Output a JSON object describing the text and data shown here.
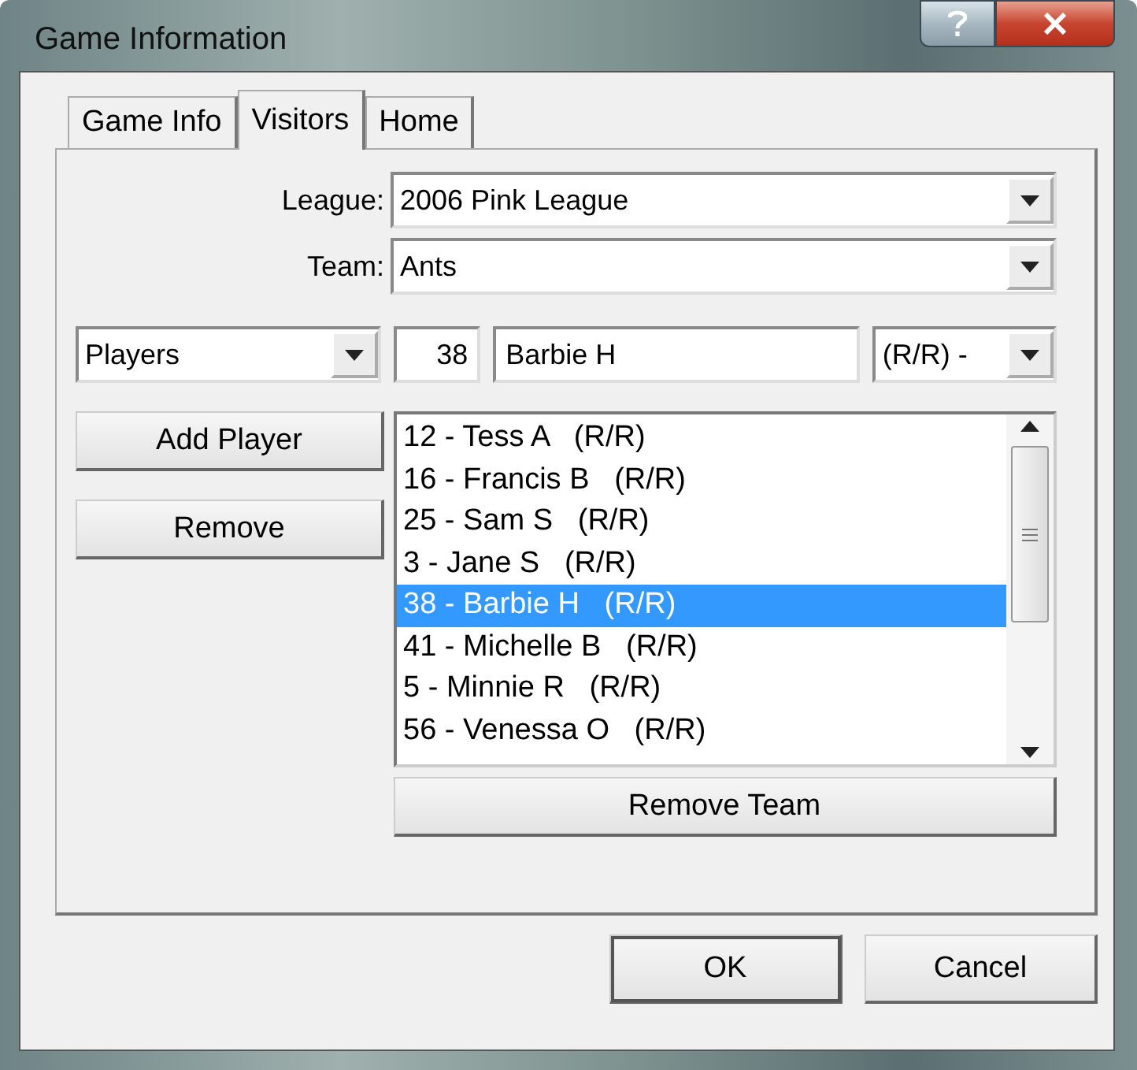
{
  "window": {
    "title": "Game Information"
  },
  "tabs": [
    {
      "label": "Game Info",
      "selected": false
    },
    {
      "label": "Visitors",
      "selected": true
    },
    {
      "label": "Home",
      "selected": false
    }
  ],
  "league": {
    "label": "League:",
    "value": "2006 Pink League"
  },
  "team": {
    "label": "Team:",
    "value": "Ants"
  },
  "player_entry": {
    "filter": "Players",
    "number": "38",
    "name": "Barbie H",
    "hand": "(R/R) -"
  },
  "side_buttons": [
    "Add Player",
    "Remove"
  ],
  "players": [
    {
      "text": "12 - Tess A   (R/R)",
      "selected": false
    },
    {
      "text": "16 - Francis B   (R/R)",
      "selected": false
    },
    {
      "text": "25 - Sam S   (R/R)",
      "selected": false
    },
    {
      "text": "3 - Jane S   (R/R)",
      "selected": false
    },
    {
      "text": "38 - Barbie H   (R/R)",
      "selected": true
    },
    {
      "text": "41 - Michelle B   (R/R)",
      "selected": false
    },
    {
      "text": "5 - Minnie R   (R/R)",
      "selected": false
    },
    {
      "text": "56 - Venessa O   (R/R)",
      "selected": false
    }
  ],
  "remove_team": "Remove Team",
  "dialog_buttons": [
    {
      "label": "OK",
      "kind": "default"
    },
    {
      "label": "Cancel",
      "kind": "normal"
    }
  ]
}
